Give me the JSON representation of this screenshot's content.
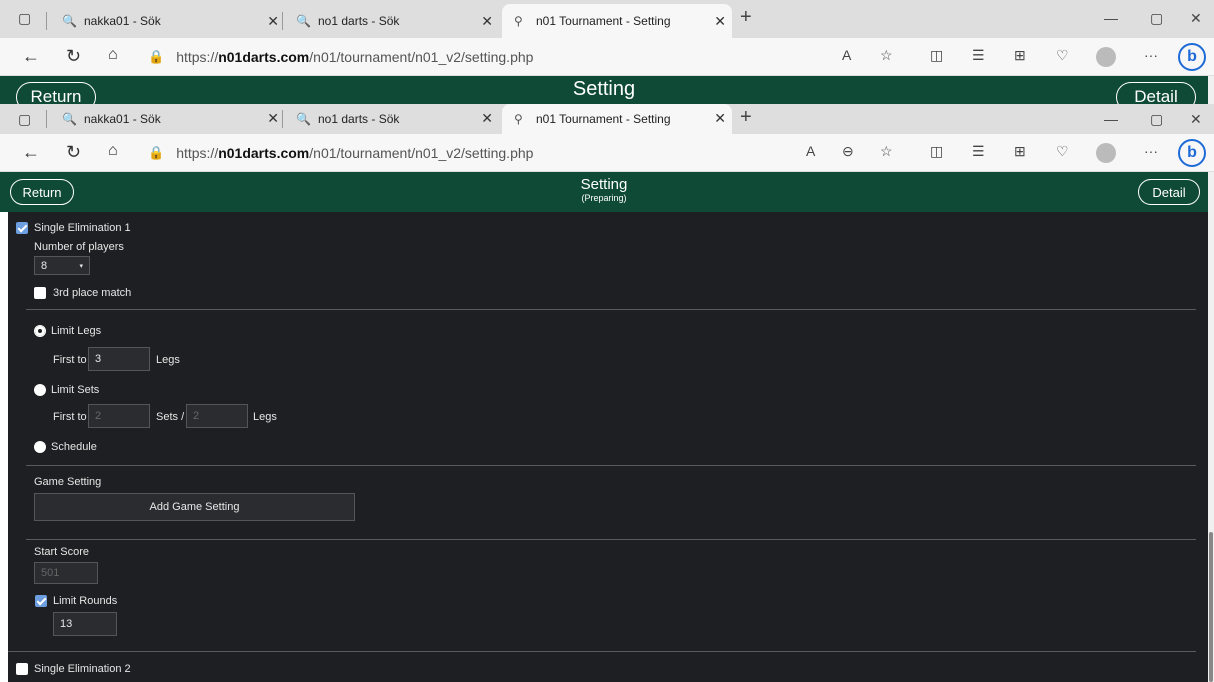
{
  "browser": {
    "tabs": [
      {
        "title": "nakka01 - Sök"
      },
      {
        "title": "no1 darts - Sök"
      },
      {
        "title": "n01 Tournament - Setting"
      }
    ],
    "url_prefix": "https://",
    "url_domain": "n01darts.com",
    "url_path": "/n01/tournament/n01_v2/setting.php"
  },
  "header": {
    "return_label": "Return",
    "title": "Setting",
    "subtitle": "(Preparing)",
    "detail_label": "Detail"
  },
  "form": {
    "single_elim_1": "Single Elimination 1",
    "num_players_label": "Number of players",
    "num_players_value": "8",
    "third_place_label": "3rd place match",
    "limit_legs_label": "Limit Legs",
    "first_to_label": "First to",
    "legs_value": "3",
    "legs_label": "Legs",
    "limit_sets_label": "Limit Sets",
    "first_to_label2": "First to",
    "sets_value": "2",
    "sets_label": "Sets /",
    "sets_legs_value": "2",
    "legs_label2": "Legs",
    "schedule_label": "Schedule",
    "game_setting_label": "Game Setting",
    "add_game_setting": "Add Game Setting",
    "start_score_label": "Start Score",
    "start_score_value": "501",
    "limit_rounds_label": "Limit Rounds",
    "limit_rounds_value": "13",
    "single_elim_2": "Single Elimination 2"
  },
  "colors": {
    "header_green": "#0f4a36",
    "content_bg": "#1e1f22",
    "checkbox_blue": "#6d9fe0"
  }
}
